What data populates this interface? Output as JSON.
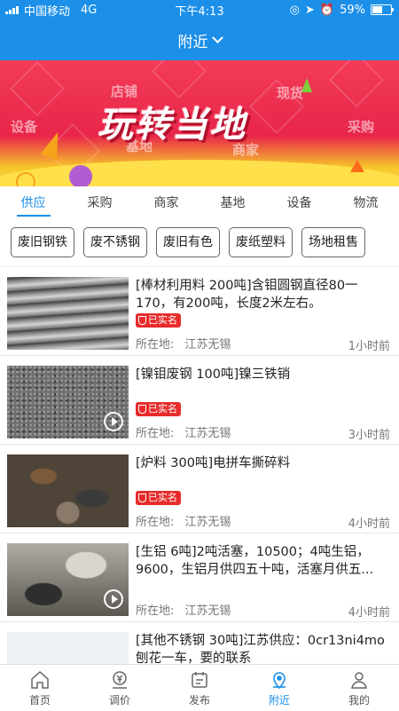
{
  "status": {
    "carrier": "中国移动",
    "network": "4G",
    "time": "下午4:13",
    "battery": "59%",
    "battery_level": 0.59
  },
  "nav": {
    "title": "附近"
  },
  "banner": {
    "title": "玩转当地",
    "deco": [
      "店铺",
      "现货",
      "设备",
      "基地",
      "商家",
      "采购"
    ]
  },
  "tabs": [
    "供应",
    "采购",
    "商家",
    "基地",
    "设备",
    "物流"
  ],
  "categories": [
    "废旧钢铁",
    "废不锈钢",
    "废旧有色",
    "废纸塑料",
    "场地租售"
  ],
  "items": [
    {
      "title": "[棒材利用料 200吨]含钼圆钢直径80一170，有200吨，长度2米左右。",
      "badge": "已实名",
      "loc_label": "所在地:",
      "loc": "江苏无锡",
      "time": "1小时前",
      "video": false
    },
    {
      "title": "[镍钼废钢 100吨]镍三铁销",
      "badge": "已实名",
      "loc_label": "所在地:",
      "loc": "江苏无锡",
      "time": "3小时前",
      "video": true
    },
    {
      "title": "[炉料 300吨]电拼车撕碎料",
      "badge": "已实名",
      "loc_label": "所在地:",
      "loc": "江苏无锡",
      "time": "4小时前",
      "video": false
    },
    {
      "title": "[生铝 6吨]2吨活塞，10500；4吨生铝，9600，生铝月供四五十吨，活塞月供五...",
      "badge": "",
      "loc_label": "所在地:",
      "loc": "江苏无锡",
      "time": "4小时前",
      "video": true
    },
    {
      "title": "[其他不锈钢 30吨]江苏供应：0cr13ni4mo刨花一车，要的联系",
      "badge": "",
      "loc_label": "",
      "loc": "",
      "time": "",
      "video": false
    }
  ],
  "tabbar": [
    "首页",
    "调价",
    "发布",
    "附近",
    "我的"
  ],
  "colors": {
    "primary": "#1c8fe8",
    "badge": "#e72b2b"
  }
}
